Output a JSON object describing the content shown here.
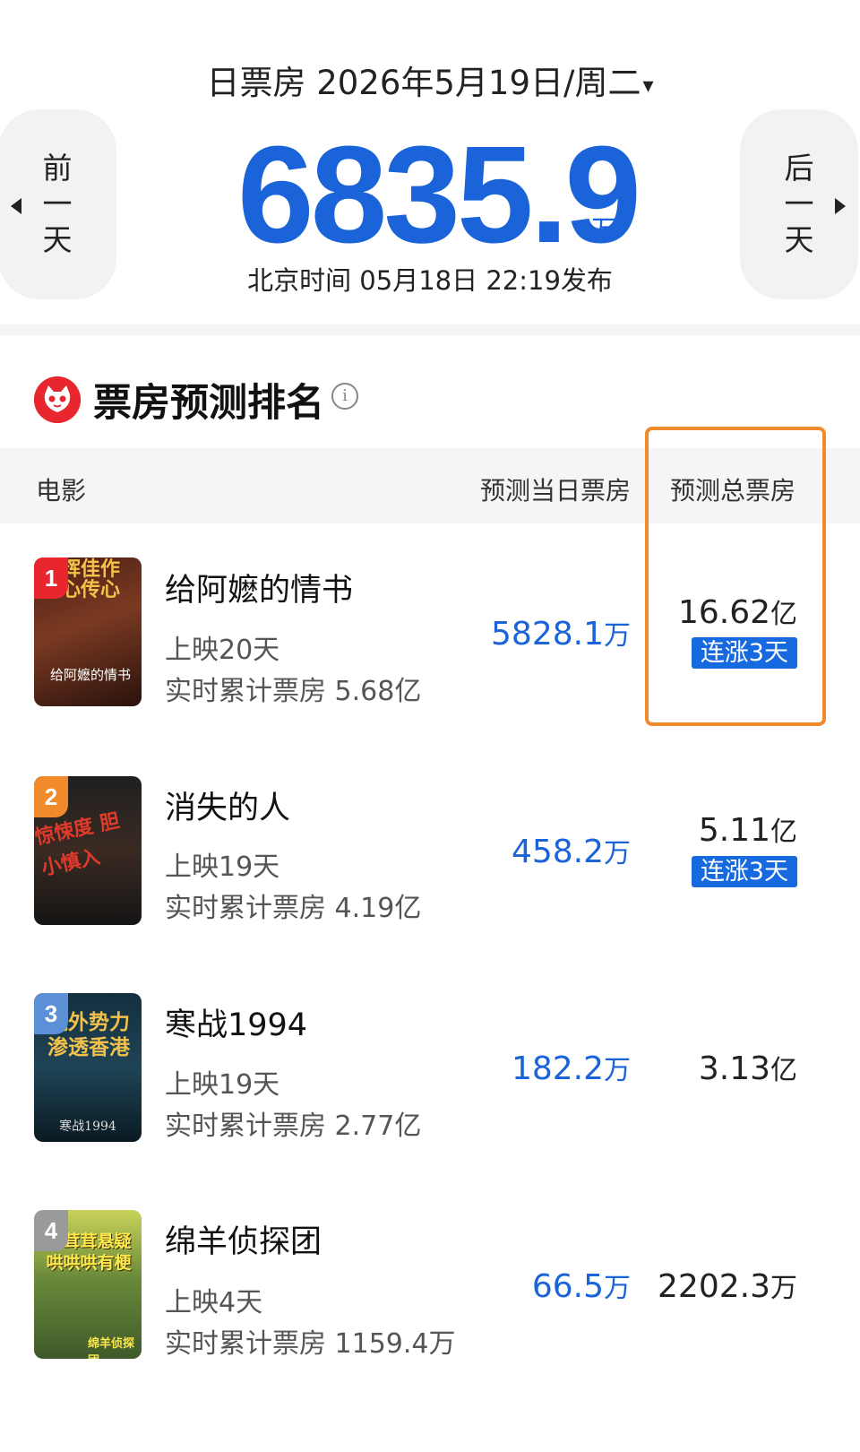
{
  "header": {
    "date_label": "日票房 2026年5月19日/周二",
    "caret": "▾",
    "prev_day": [
      "前",
      "一",
      "天"
    ],
    "next_day": [
      "后",
      "一",
      "天"
    ],
    "total_value": "6835.9",
    "total_unit": "万",
    "publish_text": "北京时间 05月18日 22:19发布"
  },
  "section": {
    "title": "票房预测排名",
    "info_icon": "i"
  },
  "table_header": {
    "movie": "电影",
    "daily_forecast": "预测当日票房",
    "total_forecast": "预测总票房"
  },
  "movies": [
    {
      "rank": "1",
      "title": "给阿嬷的情书",
      "days": "上映20天",
      "cumulative": "实时累计票房 5.68亿",
      "daily_num": "5828.1",
      "daily_unit": "万",
      "total_num": "16.62",
      "total_unit": "亿",
      "streak": "连涨3天",
      "poster_text": "辉佳作 心传心",
      "poster_sub": "给阿嬷的情书",
      "badge_color": "#e8262d"
    },
    {
      "rank": "2",
      "title": "消失的人",
      "days": "上映19天",
      "cumulative": "实时累计票房 4.19亿",
      "daily_num": "458.2",
      "daily_unit": "万",
      "total_num": "5.11",
      "total_unit": "亿",
      "streak": "连涨3天",
      "poster_text": "惊悚度 胆小慎入",
      "poster_sub": "",
      "badge_color": "#f08a2b"
    },
    {
      "rank": "3",
      "title": "寒战1994",
      "days": "上映19天",
      "cumulative": "实时累计票房 2.77亿",
      "daily_num": "182.2",
      "daily_unit": "万",
      "total_num": "3.13",
      "total_unit": "亿",
      "streak": "",
      "poster_text": "境外势力 渗透香港",
      "poster_sub": "寒战1994",
      "badge_color": "#5b8fd6"
    },
    {
      "rank": "4",
      "title": "绵羊侦探团",
      "days": "上映4天",
      "cumulative": "实时累计票房 1159.4万",
      "daily_num": "66.5",
      "daily_unit": "万",
      "total_num": "2202.3",
      "total_unit": "万",
      "streak": "",
      "poster_text": "毛茸茸悬疑 哄哄哄有梗",
      "poster_sub": "绵羊侦探团",
      "badge_color": "#9a9a9a"
    }
  ]
}
